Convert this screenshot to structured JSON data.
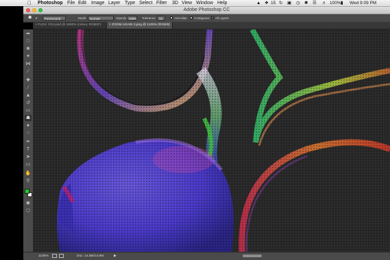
{
  "menubar": {
    "app_name": "Photoshop",
    "items": [
      "File",
      "Edit",
      "Image",
      "Layer",
      "Type",
      "Select",
      "Filter",
      "3D",
      "View",
      "Window",
      "Help"
    ],
    "battery": "100%",
    "clock": "Wed 9:09 PM",
    "badge_count": "15"
  },
  "window": {
    "title": "Adobe Photoshop CC"
  },
  "options": {
    "sample_source": "Foreground",
    "mode_label": "Mode:",
    "mode_value": "Normal",
    "opacity_label": "Opacity:",
    "opacity_value": "100%",
    "tolerance_label": "Tolerance:",
    "tolerance_value": "32",
    "anti_alias_label": "Anti-alias",
    "contiguous_label": "Contiguous",
    "all_layers_label": "All Layers"
  },
  "tabs": [
    {
      "label": "FUCK YOU.psd @ 1600% (colour, RGB/8*)"
    },
    {
      "label": "ZOOM AGAIN 3.png @ 1100% (RGB/8)"
    }
  ],
  "tools": [
    "move-icon",
    "marquee-icon",
    "lasso-icon",
    "quick-select-icon",
    "crop-icon",
    "eyedropper-icon",
    "spot-heal-icon",
    "brush-icon",
    "clone-stamp-icon",
    "history-brush-icon",
    "eraser-icon",
    "paint-bucket-icon",
    "blur-icon",
    "dodge-icon",
    "pen-icon",
    "type-icon",
    "path-select-icon",
    "shape-icon",
    "hand-icon",
    "zoom-icon"
  ],
  "colors": {
    "foreground": "#1fd21f",
    "background": "#ffffff"
  },
  "statusbar": {
    "zoom": "1100%",
    "doc_info": "Doc: 14.8M/14.8M"
  }
}
